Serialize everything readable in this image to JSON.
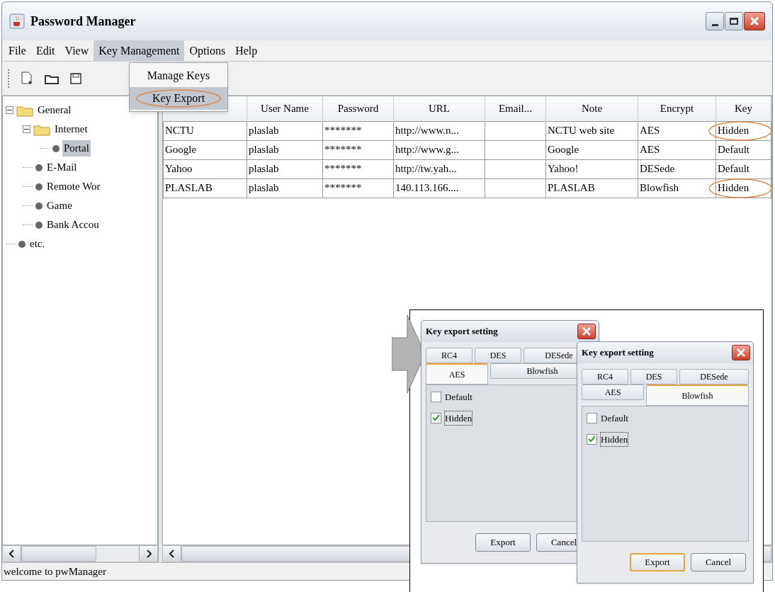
{
  "window": {
    "title": "Password Manager"
  },
  "menus": [
    {
      "label": "File",
      "open": false
    },
    {
      "label": "Edit",
      "open": false
    },
    {
      "label": "View",
      "open": false
    },
    {
      "label": "Key Management",
      "open": true
    },
    {
      "label": "Options",
      "open": false
    },
    {
      "label": "Help",
      "open": false
    }
  ],
  "open_menu": {
    "items": [
      {
        "label": "Manage Keys",
        "selected": false,
        "circled": false
      },
      {
        "label": "Key Export",
        "selected": true,
        "circled": true
      }
    ]
  },
  "tree": [
    {
      "label": "General",
      "kind": "folder",
      "expanded": true,
      "selected": false,
      "children": [
        {
          "label": "Internet",
          "kind": "folder",
          "expanded": true,
          "selected": false,
          "children": [
            {
              "label": "Portal",
              "kind": "leaf",
              "selected": true
            }
          ]
        },
        {
          "label": "E-Mail",
          "kind": "leaf",
          "selected": false
        },
        {
          "label": "Remote Wor",
          "kind": "leaf",
          "selected": false
        },
        {
          "label": "Game",
          "kind": "leaf",
          "selected": false
        },
        {
          "label": "Bank Accou",
          "kind": "leaf",
          "selected": false
        }
      ]
    },
    {
      "label": "etc.",
      "kind": "leaf",
      "selected": false
    }
  ],
  "table": {
    "column_headers": [
      "User Name",
      "Password",
      "URL",
      "Email...",
      "Note",
      "Encrypt",
      "Key"
    ],
    "rows": [
      {
        "title": "NCTU",
        "user": "plaslab",
        "password": "*******",
        "url": "http://www.n...",
        "note": "NCTU web site",
        "encrypt": "AES",
        "key": "Hidden",
        "circled": true
      },
      {
        "title": "Google",
        "user": "plaslab",
        "password": "*******",
        "url": "http://www.g...",
        "note": "Google",
        "encrypt": "AES",
        "key": "Default",
        "circled": false
      },
      {
        "title": "Yahoo",
        "user": "plaslab",
        "password": "*******",
        "url": "http://tw.yah...",
        "note": "Yahoo!",
        "encrypt": "DESede",
        "key": "Default",
        "circled": false
      },
      {
        "title": "PLASLAB",
        "user": "plaslab",
        "password": "*******",
        "url": "140.113.166....",
        "note": "PLASLAB",
        "encrypt": "Blowfish",
        "key": "Hidden",
        "circled": true
      }
    ]
  },
  "status_bar": "welcome to pwManager",
  "dialogs": [
    {
      "title": "Key export setting",
      "tab_rows": [
        [
          {
            "label": "RC4",
            "selected": false
          },
          {
            "label": "DES",
            "selected": false
          },
          {
            "label": "DESede",
            "selected": false
          }
        ],
        [
          {
            "label": "AES",
            "selected": true
          },
          {
            "label": "Blowfish",
            "selected": false
          }
        ]
      ],
      "options": [
        {
          "label": "Default",
          "checked": false,
          "focused": false
        },
        {
          "label": "Hidden",
          "checked": true,
          "focused": true
        }
      ],
      "buttons": [
        {
          "label": "Export",
          "focused": false
        },
        {
          "label": "Cancel",
          "focused": false
        }
      ]
    },
    {
      "title": "Key export setting",
      "tab_rows": [
        [
          {
            "label": "RC4",
            "selected": false
          },
          {
            "label": "DES",
            "selected": false
          },
          {
            "label": "DESede",
            "selected": false
          }
        ],
        [
          {
            "label": "AES",
            "selected": false
          },
          {
            "label": "Blowfish",
            "selected": true
          }
        ]
      ],
      "options": [
        {
          "label": "Default",
          "checked": false,
          "focused": false
        },
        {
          "label": "Hidden",
          "checked": true,
          "focused": true
        }
      ],
      "buttons": [
        {
          "label": "Export",
          "focused": true
        },
        {
          "label": "Cancel",
          "focused": false
        }
      ]
    }
  ]
}
